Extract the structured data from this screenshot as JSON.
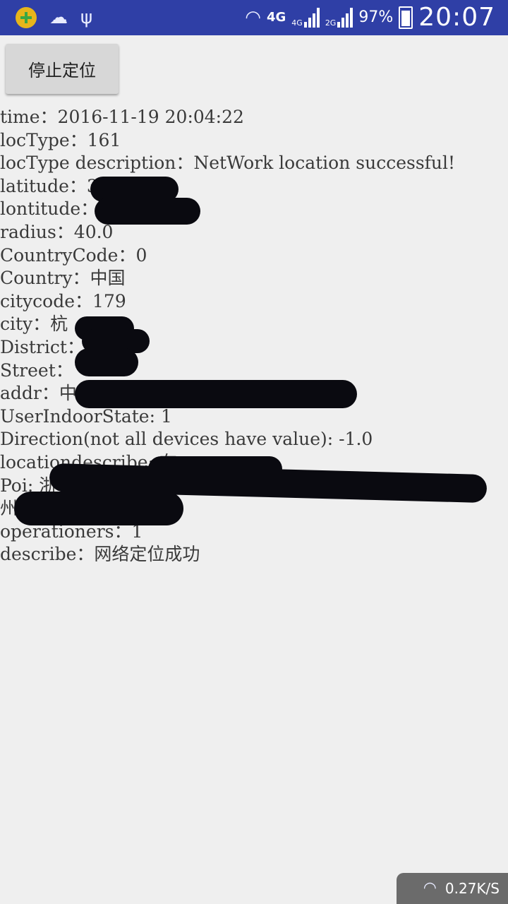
{
  "status_bar": {
    "left_icons": [
      "app-plus-icon",
      "cloud-rain-icon",
      "usb-icon"
    ],
    "network_label": "4G",
    "sim1_label": "4G",
    "sim2_label": "2G",
    "battery": "97%",
    "time": "20:07"
  },
  "toolbar": {
    "stop_label": "停止定位"
  },
  "info_lines": [
    "time：2016-11-19 20:04:22",
    "locType：161",
    "locType description：NetWork location successful!",
    "latitude：3",
    "lontitude：",
    "radius：40.0",
    "CountryCode：0",
    "Country：中国",
    "citycode：179",
    "city：杭",
    "District：",
    "Street：",
    "addr：中",
    "UserIndoorState: 1",
    "Direction(not all devices have value): -1.0",
    "locationdescribe: 在",
    "Poi: 浙",
    "州",
    "operationers：1",
    "describe：网络定位成功"
  ],
  "network_speed": "0.27K/S",
  "colors": {
    "status_bar": "#2f3fa6",
    "background": "#efefef",
    "button": "#d7d7d7"
  }
}
